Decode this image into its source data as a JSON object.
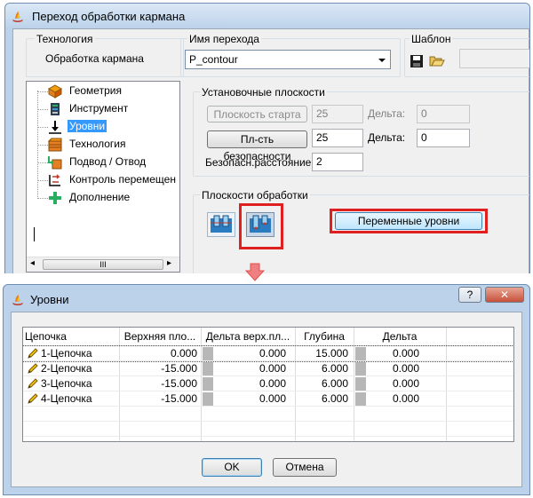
{
  "top_window": {
    "title": "Переход обработки кармана",
    "technology_label": "Технология",
    "technology_value": "Обработка кармана",
    "name_label": "Имя перехода",
    "name_value": "P_contour",
    "template_label": "Шаблон",
    "tree": [
      {
        "label": "Геометрия",
        "icon": "geometry-icon",
        "selected": false
      },
      {
        "label": "Инструмент",
        "icon": "tool-icon",
        "selected": false
      },
      {
        "label": "Уровни",
        "icon": "levels-icon",
        "selected": true
      },
      {
        "label": "Технология",
        "icon": "technology-icon",
        "selected": false
      },
      {
        "label": "Подвод / Отвод",
        "icon": "approach-icon",
        "selected": false
      },
      {
        "label": "Контроль перемещен",
        "icon": "motion-control-icon",
        "selected": false
      },
      {
        "label": "Дополнение",
        "icon": "plus-icon",
        "selected": false
      }
    ],
    "scroll_thumb_label": "III",
    "setup_planes": {
      "title": "Установочные плоскости",
      "start_plane_button": "Плоскость старта",
      "start_plane_value": "25",
      "start_delta_label": "Дельта:",
      "start_delta_value": "0",
      "safety_plane_button": "Пл-сть безопасности",
      "safety_plane_value": "25",
      "safety_delta_label": "Дельта:",
      "safety_delta_value": "0",
      "safe_distance_label": "Безопасн.расстояние:",
      "safe_distance_value": "2"
    },
    "machining_planes": {
      "title": "Плоскости обработки",
      "variable_levels_button": "Переменные уровни"
    }
  },
  "levels_dialog": {
    "title": "Уровни",
    "help_label": "?",
    "close_label": "✕",
    "columns": [
      "Цепочка",
      "Верхняя пло...",
      "Дельта верх.пл...",
      "Глубина",
      "Дельта"
    ],
    "rows": [
      {
        "chain": "1-Цепочка",
        "top": "0.000",
        "top_delta": "0.000",
        "depth": "15.000",
        "delta": "0.000"
      },
      {
        "chain": "2-Цепочка",
        "top": "-15.000",
        "top_delta": "0.000",
        "depth": "6.000",
        "delta": "0.000"
      },
      {
        "chain": "3-Цепочка",
        "top": "-15.000",
        "top_delta": "0.000",
        "depth": "6.000",
        "delta": "0.000"
      },
      {
        "chain": "4-Цепочка",
        "top": "-15.000",
        "top_delta": "0.000",
        "depth": "6.000",
        "delta": "0.000"
      }
    ],
    "ok_label": "OK",
    "cancel_label": "Отмена"
  },
  "colors": {
    "highlight_red": "#e02020",
    "selection_blue": "#3399ff"
  }
}
